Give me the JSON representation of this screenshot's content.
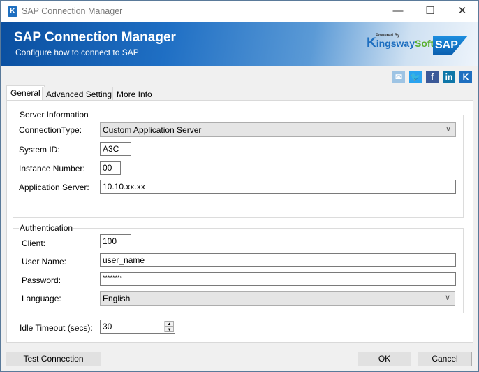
{
  "window": {
    "title": "SAP Connection Manager",
    "app_icon": "K",
    "controls": [
      "minimize-icon",
      "maximize-icon",
      "close-icon"
    ]
  },
  "banner": {
    "title": "SAP Connection Manager",
    "subtitle": "Configure how to connect to SAP",
    "powered_by": "Powered By",
    "brand_k": "K",
    "brand_ingsway": "ingsway",
    "brand_soft": "Soft",
    "sap_logo": "SAP"
  },
  "social": [
    {
      "name": "email-icon",
      "glyph": "✉",
      "color": "#9ec4e4"
    },
    {
      "name": "twitter-icon",
      "glyph": "🐦",
      "color": "#2aa3ef"
    },
    {
      "name": "facebook-icon",
      "glyph": "f",
      "color": "#3b5998"
    },
    {
      "name": "linkedin-icon",
      "glyph": "in",
      "color": "#0e76a8"
    },
    {
      "name": "kingswaysoft-icon",
      "glyph": "K",
      "color": "#1e6fc0"
    }
  ],
  "tabs": [
    {
      "label": "General",
      "active": true
    },
    {
      "label": "Advanced Settings"
    },
    {
      "label": "More Info"
    }
  ],
  "server": {
    "group": "Server Information",
    "connection_type_label": "ConnectionType:",
    "connection_type": "Custom Application Server",
    "system_id_label": "System ID:",
    "system_id": "A3C",
    "instance_label": "Instance Number:",
    "instance": "00",
    "app_server_label": "Application Server:",
    "app_server": "10.10.xx.xx"
  },
  "auth": {
    "group": "Authentication",
    "client_label": "Client:",
    "client": "100",
    "user_label": "User Name:",
    "user": "user_name",
    "password_label": "Password:",
    "password": "********",
    "language_label": "Language:",
    "language": "English"
  },
  "idle": {
    "label": "Idle Timeout (secs):",
    "value": "30"
  },
  "buttons": {
    "test": "Test Connection",
    "ok": "OK",
    "cancel": "Cancel"
  }
}
